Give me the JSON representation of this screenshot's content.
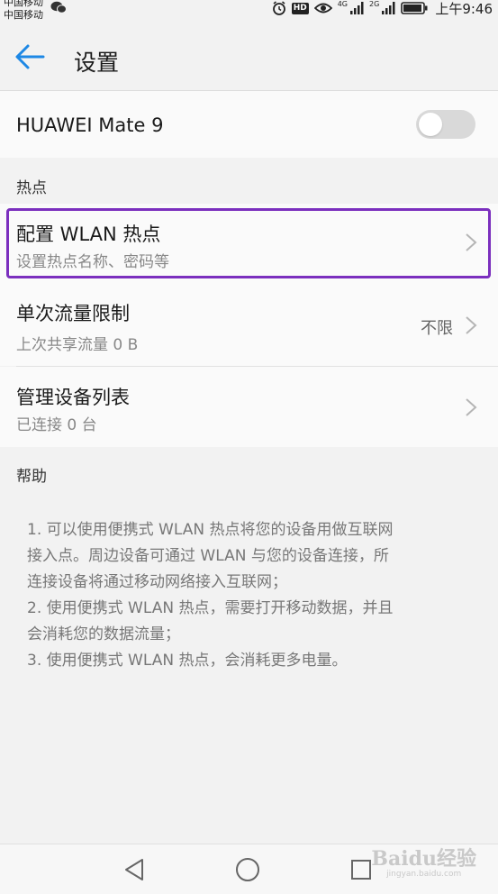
{
  "status_bar": {
    "carrier_1": "中国移动",
    "carrier_2": "中国移动",
    "hd": "HD",
    "net_1": "4G",
    "net_2": "2G",
    "time": "上午9:46"
  },
  "header": {
    "title": "设置"
  },
  "device": {
    "name": "HUAWEI Mate 9",
    "toggle_on": false
  },
  "sections": {
    "hotspot": "热点",
    "help": "帮助"
  },
  "rows": [
    {
      "title": "配置 WLAN 热点",
      "subtitle": "设置热点名称、密码等",
      "value": ""
    },
    {
      "title": "单次流量限制",
      "subtitle": "上次共享流量 0 B",
      "value": "不限"
    },
    {
      "title": "管理设备列表",
      "subtitle": "已连接 0 台",
      "value": ""
    }
  ],
  "help_lines": [
    "1. 可以使用便携式 WLAN 热点将您的设备用做互联网",
    "接入点。周边设备可通过 WLAN 与您的设备连接，所",
    "连接设备将通过移动网络接入互联网；",
    "2. 使用便携式 WLAN 热点，需要打开移动数据，并且",
    "会消耗您的数据流量；",
    "3. 使用便携式 WLAN 热点，会消耗更多电量。"
  ],
  "watermark": {
    "brand": "Baidu经验",
    "url": "jingyan.baidu.com"
  },
  "colors": {
    "accent": "#1e88e5",
    "highlight": "#7b2fbe"
  }
}
